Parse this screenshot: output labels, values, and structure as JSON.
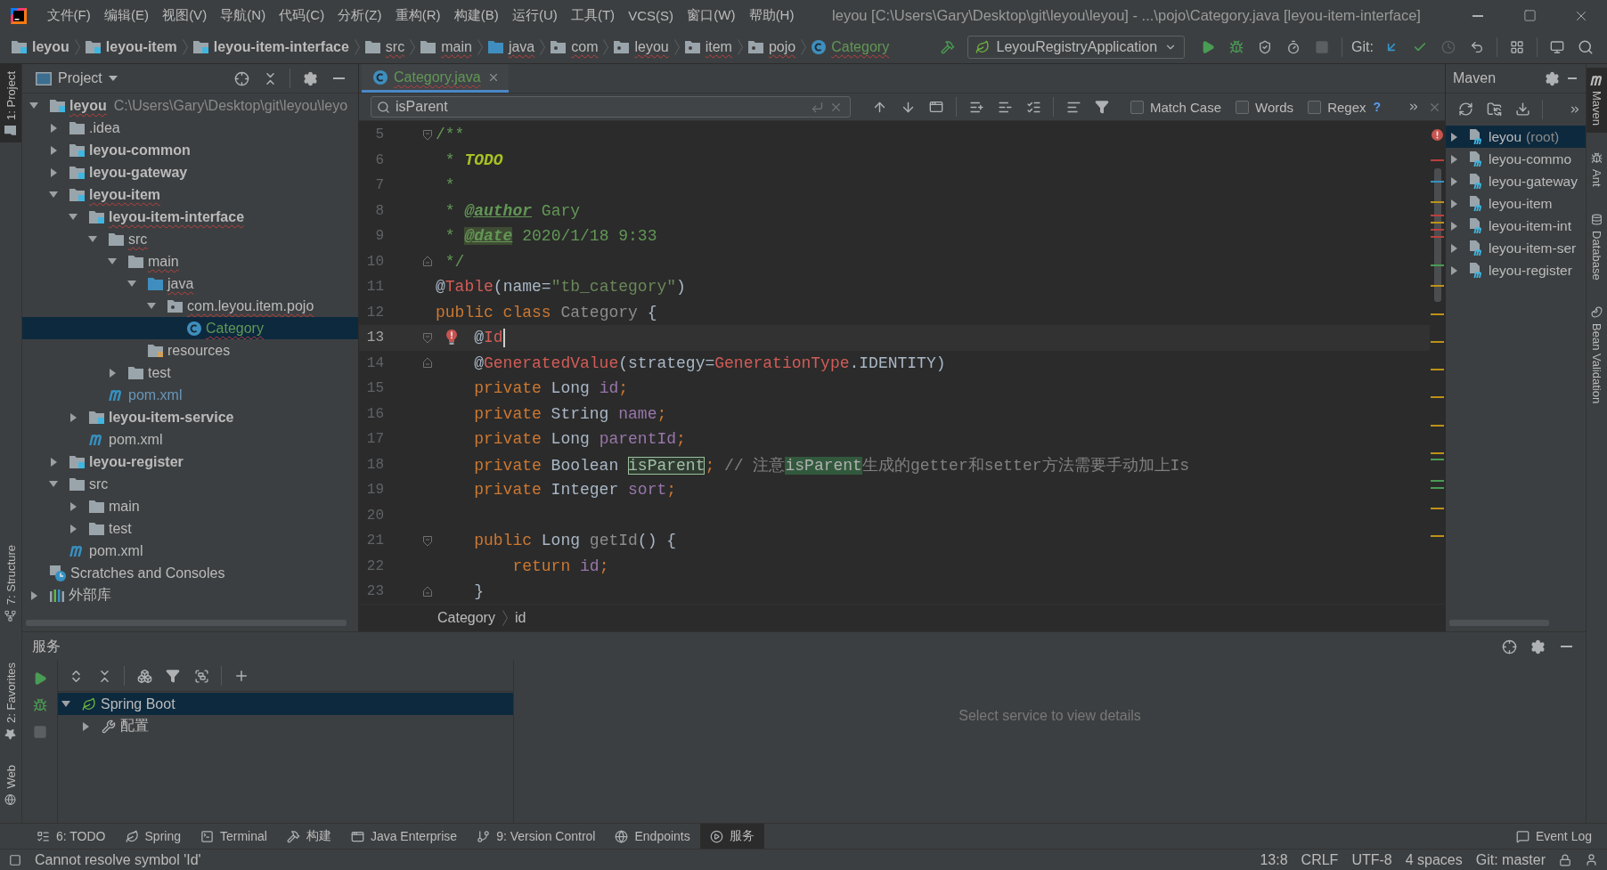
{
  "window": {
    "title": "leyou [C:\\Users\\Gary\\Desktop\\git\\leyou\\leyou] - ...\\pojo\\Category.java [leyou-item-interface]"
  },
  "menu": [
    "文件(F)",
    "编辑(E)",
    "视图(V)",
    "导航(N)",
    "代码(C)",
    "分析(Z)",
    "重构(R)",
    "构建(B)",
    "运行(U)",
    "工具(T)",
    "VCS(S)",
    "窗口(W)",
    "帮助(H)"
  ],
  "navbar": {
    "crumbs": [
      {
        "label": "leyou",
        "kind": "module",
        "errors": false,
        "added": false
      },
      {
        "label": "leyou-item",
        "kind": "module",
        "errors": false,
        "added": false
      },
      {
        "label": "leyou-item-interface",
        "kind": "module",
        "errors": false,
        "added": false
      },
      {
        "label": "src",
        "kind": "folder",
        "errors": true,
        "added": false
      },
      {
        "label": "main",
        "kind": "folder",
        "errors": true,
        "added": false
      },
      {
        "label": "java",
        "kind": "source",
        "errors": true,
        "added": false
      },
      {
        "label": "com",
        "kind": "package",
        "errors": true,
        "added": false
      },
      {
        "label": "leyou",
        "kind": "package",
        "errors": true,
        "added": false
      },
      {
        "label": "item",
        "kind": "package",
        "errors": true,
        "added": false
      },
      {
        "label": "pojo",
        "kind": "package",
        "errors": true,
        "added": false
      },
      {
        "label": "Category",
        "kind": "class",
        "errors": true,
        "added": true
      }
    ],
    "run_config": "LeyouRegistryApplication",
    "run_actions": [
      {
        "kind": "run",
        "disabled": false
      },
      {
        "kind": "debug",
        "disabled": false
      },
      {
        "kind": "coverage",
        "disabled": false
      },
      {
        "kind": "profile",
        "disabled": false
      },
      {
        "kind": "stop",
        "disabled": true
      }
    ],
    "git_label": "Git:",
    "git_actions": [
      {
        "kind": "update",
        "disabled": false
      },
      {
        "kind": "commit",
        "disabled": false
      },
      {
        "kind": "history",
        "disabled": true
      },
      {
        "kind": "rollback",
        "disabled": false
      }
    ]
  },
  "left_stripe": {
    "top": [
      {
        "label": "1: Project",
        "kind": "project",
        "selected": true
      },
      {
        "label": "7: Structure",
        "kind": "structure",
        "selected": false
      }
    ],
    "bottom": [
      {
        "label": "2: Favorites",
        "kind": "favorites",
        "selected": false
      },
      {
        "label": "Web",
        "kind": "web",
        "selected": false
      }
    ]
  },
  "project_panel": {
    "title": "Project",
    "tree": [
      {
        "label": "leyou",
        "kind": "module",
        "path": "C:\\Users\\Gary\\Desktop\\git\\leyou\\leyo",
        "expanded": true,
        "selected": false,
        "errors": true,
        "added": false,
        "modified": false,
        "children": [
          {
            "label": ".idea",
            "kind": "folder",
            "expanded": false,
            "selected": false,
            "errors": false,
            "added": false,
            "modified": false
          },
          {
            "label": "leyou-common",
            "kind": "module",
            "expanded": false,
            "selected": false,
            "errors": false,
            "added": false,
            "modified": false
          },
          {
            "label": "leyou-gateway",
            "kind": "module",
            "expanded": false,
            "selected": false,
            "errors": false,
            "added": false,
            "modified": false
          },
          {
            "label": "leyou-item",
            "kind": "module",
            "expanded": true,
            "selected": false,
            "errors": true,
            "added": false,
            "modified": false,
            "children": [
              {
                "label": "leyou-item-interface",
                "kind": "module",
                "expanded": true,
                "selected": false,
                "errors": true,
                "added": false,
                "modified": false,
                "children": [
                  {
                    "label": "src",
                    "kind": "folder",
                    "expanded": true,
                    "selected": false,
                    "errors": true,
                    "added": false,
                    "modified": false,
                    "children": [
                      {
                        "label": "main",
                        "kind": "folder",
                        "expanded": true,
                        "selected": false,
                        "errors": true,
                        "added": false,
                        "modified": false,
                        "children": [
                          {
                            "label": "java",
                            "kind": "source",
                            "expanded": true,
                            "selected": false,
                            "errors": true,
                            "added": false,
                            "modified": false,
                            "children": [
                              {
                                "label": "com.leyou.item.pojo",
                                "kind": "package",
                                "expanded": true,
                                "selected": false,
                                "errors": true,
                                "added": false,
                                "modified": false,
                                "children": [
                                  {
                                    "label": "Category",
                                    "kind": "class",
                                    "selected": true,
                                    "errors": true,
                                    "added": true,
                                    "modified": false
                                  }
                                ]
                              }
                            ]
                          },
                          {
                            "label": "resources",
                            "kind": "resources",
                            "selected": false,
                            "errors": false,
                            "added": false,
                            "modified": false
                          }
                        ]
                      },
                      {
                        "label": "test",
                        "kind": "folder",
                        "expanded": false,
                        "selected": false,
                        "errors": false,
                        "added": false,
                        "modified": false
                      }
                    ]
                  },
                  {
                    "label": "pom.xml",
                    "kind": "pom",
                    "selected": false,
                    "errors": false,
                    "added": false,
                    "modified": true
                  }
                ]
              },
              {
                "label": "leyou-item-service",
                "kind": "module",
                "expanded": false,
                "selected": false,
                "errors": false,
                "added": false,
                "modified": false
              },
              {
                "label": "pom.xml",
                "kind": "pom",
                "selected": false,
                "errors": false,
                "added": false,
                "modified": false
              }
            ]
          },
          {
            "label": "leyou-register",
            "kind": "module",
            "expanded": false,
            "selected": false,
            "errors": false,
            "added": false,
            "modified": false
          },
          {
            "label": "src",
            "kind": "folder",
            "expanded": true,
            "selected": false,
            "errors": false,
            "added": false,
            "modified": false,
            "children": [
              {
                "label": "main",
                "kind": "folder",
                "expanded": false,
                "selected": false,
                "errors": false,
                "added": false,
                "modified": false
              },
              {
                "label": "test",
                "kind": "folder",
                "expanded": false,
                "selected": false,
                "errors": false,
                "added": false,
                "modified": false
              }
            ]
          },
          {
            "label": "pom.xml",
            "kind": "pom",
            "selected": false,
            "errors": false,
            "added": false,
            "modified": false
          }
        ]
      },
      {
        "label": "Scratches and Consoles",
        "kind": "scratches",
        "selected": false,
        "errors": false,
        "added": false,
        "modified": false
      },
      {
        "label": "外部库",
        "kind": "library",
        "expanded": false,
        "selected": false,
        "errors": false,
        "added": false,
        "modified": false
      }
    ]
  },
  "editor": {
    "tabs": [
      {
        "label": "Category.java",
        "selected": true,
        "errors": true,
        "added": true
      }
    ],
    "find": {
      "value": "isParent",
      "options": [
        {
          "label": "Match Case",
          "checked": false
        },
        {
          "label": "Words",
          "checked": false
        },
        {
          "label": "Regex",
          "checked": false
        }
      ],
      "help": "?"
    },
    "lines": [
      {
        "number": "5",
        "fold": {
          "kind": "open"
        },
        "current": false,
        "caret": false,
        "bulb": false,
        "tokens": [
          {
            "kind": "doc",
            "text": "/**"
          }
        ]
      },
      {
        "number": "6",
        "current": false,
        "caret": false,
        "bulb": false,
        "tokens": [
          {
            "kind": "doc",
            "text": " * "
          },
          {
            "kind": "todo",
            "text": "TODO"
          }
        ]
      },
      {
        "number": "7",
        "current": false,
        "caret": false,
        "bulb": false,
        "tokens": [
          {
            "kind": "doc",
            "text": " *"
          }
        ]
      },
      {
        "number": "8",
        "current": false,
        "caret": false,
        "bulb": false,
        "tokens": [
          {
            "kind": "doc",
            "text": " * "
          },
          {
            "kind": "doc-tag",
            "text": "@author"
          },
          {
            "kind": "doc",
            "text": " Gary"
          }
        ]
      },
      {
        "number": "9",
        "current": false,
        "caret": false,
        "bulb": false,
        "tokens": [
          {
            "kind": "doc",
            "text": " * "
          },
          {
            "kind": "doc-tag-warn",
            "text": "@date"
          },
          {
            "kind": "doc",
            "text": " 2020/1/18 9:33"
          }
        ]
      },
      {
        "number": "10",
        "fold": {
          "kind": "close"
        },
        "current": false,
        "caret": false,
        "bulb": false,
        "tokens": [
          {
            "kind": "doc",
            "text": " */"
          }
        ]
      },
      {
        "number": "11",
        "current": false,
        "caret": false,
        "bulb": false,
        "tokens": [
          {
            "kind": "plain",
            "text": "@"
          },
          {
            "kind": "unresolved",
            "text": "Table"
          },
          {
            "kind": "plain",
            "text": "(name="
          },
          {
            "kind": "string",
            "text": "\"tb_category\""
          },
          {
            "kind": "plain",
            "text": ")"
          }
        ]
      },
      {
        "number": "12",
        "current": false,
        "caret": false,
        "bulb": false,
        "tokens": [
          {
            "kind": "keyword",
            "text": "public class "
          },
          {
            "kind": "unused",
            "text": "Category"
          },
          {
            "kind": "plain",
            "text": " {"
          }
        ]
      },
      {
        "number": "13",
        "fold": {
          "kind": "open"
        },
        "current": true,
        "caret": true,
        "bulb": true,
        "tokens": [
          {
            "kind": "plain",
            "text": "    @"
          },
          {
            "kind": "unresolved",
            "text": "Id"
          }
        ]
      },
      {
        "number": "14",
        "fold": {
          "kind": "close"
        },
        "current": false,
        "caret": false,
        "bulb": false,
        "tokens": [
          {
            "kind": "plain",
            "text": "    @"
          },
          {
            "kind": "unresolved",
            "text": "GeneratedValue"
          },
          {
            "kind": "plain",
            "text": "(strategy="
          },
          {
            "kind": "unresolved",
            "text": "GenerationType"
          },
          {
            "kind": "plain",
            "text": ".IDENTITY)"
          }
        ]
      },
      {
        "number": "15",
        "current": false,
        "caret": false,
        "bulb": false,
        "tokens": [
          {
            "kind": "keyword",
            "text": "    private "
          },
          {
            "kind": "plain",
            "text": "Long "
          },
          {
            "kind": "field",
            "text": "id"
          },
          {
            "kind": "keyword",
            "text": ";"
          }
        ]
      },
      {
        "number": "16",
        "current": false,
        "caret": false,
        "bulb": false,
        "tokens": [
          {
            "kind": "keyword",
            "text": "    private "
          },
          {
            "kind": "plain",
            "text": "String "
          },
          {
            "kind": "field",
            "text": "name"
          },
          {
            "kind": "keyword",
            "text": ";"
          }
        ]
      },
      {
        "number": "17",
        "current": false,
        "caret": false,
        "bulb": false,
        "tokens": [
          {
            "kind": "keyword",
            "text": "    private "
          },
          {
            "kind": "plain",
            "text": "Long "
          },
          {
            "kind": "field",
            "text": "parentId"
          },
          {
            "kind": "keyword",
            "text": ";"
          }
        ]
      },
      {
        "number": "18",
        "current": false,
        "caret": false,
        "bulb": false,
        "tokens": [
          {
            "kind": "keyword",
            "text": "    private "
          },
          {
            "kind": "plain",
            "text": "Boolean "
          },
          {
            "kind": "match-current",
            "text": "isParent"
          },
          {
            "kind": "keyword",
            "text": ";"
          },
          {
            "kind": "comment",
            "text": " // 注意"
          },
          {
            "kind": "match",
            "text": "isParent"
          },
          {
            "kind": "comment",
            "text": "生成的getter和setter方法需要手动加上Is"
          }
        ]
      },
      {
        "number": "19",
        "current": false,
        "caret": false,
        "bulb": false,
        "tokens": [
          {
            "kind": "keyword",
            "text": "    private "
          },
          {
            "kind": "plain",
            "text": "Integer "
          },
          {
            "kind": "field",
            "text": "sort"
          },
          {
            "kind": "keyword",
            "text": ";"
          }
        ]
      },
      {
        "number": "20",
        "current": false,
        "caret": false,
        "bulb": false
      },
      {
        "number": "21",
        "fold": {
          "kind": "open"
        },
        "current": false,
        "caret": false,
        "bulb": false,
        "tokens": [
          {
            "kind": "keyword",
            "text": "    public "
          },
          {
            "kind": "plain",
            "text": "Long "
          },
          {
            "kind": "unused",
            "text": "getId"
          },
          {
            "kind": "plain",
            "text": "() {"
          }
        ]
      },
      {
        "number": "22",
        "current": false,
        "caret": false,
        "bulb": false,
        "tokens": [
          {
            "kind": "keyword",
            "text": "        return "
          },
          {
            "kind": "field",
            "text": "id"
          },
          {
            "kind": "keyword",
            "text": ";"
          }
        ]
      },
      {
        "number": "23",
        "fold": {
          "kind": "close"
        },
        "current": false,
        "caret": false,
        "bulb": false,
        "tokens": [
          {
            "kind": "plain",
            "text": "    }"
          }
        ]
      }
    ],
    "breadcrumbs": [
      "Category",
      "id"
    ]
  },
  "maven": {
    "title": "Maven",
    "items": [
      {
        "label": "leyou",
        "suffix": "(root)",
        "expanded": false,
        "selected": true
      },
      {
        "label": "leyou-commo",
        "expanded": false,
        "selected": false
      },
      {
        "label": "leyou-gateway",
        "expanded": false,
        "selected": false
      },
      {
        "label": "leyou-item",
        "expanded": false,
        "selected": false
      },
      {
        "label": "leyou-item-int",
        "expanded": false,
        "selected": false
      },
      {
        "label": "leyou-item-ser",
        "expanded": false,
        "selected": false
      },
      {
        "label": "leyou-register",
        "expanded": false,
        "selected": false
      }
    ]
  },
  "right_stripe": [
    {
      "label": "Maven",
      "kind": "maven",
      "selected": true
    },
    {
      "label": "Ant",
      "kind": "ant",
      "selected": false
    },
    {
      "label": "Database",
      "kind": "database",
      "selected": false
    },
    {
      "label": "Bean Validation",
      "kind": "bean",
      "selected": false
    }
  ],
  "services": {
    "title": "服务",
    "actions": [
      {
        "kind": "run",
        "disabled": false
      },
      {
        "kind": "debug",
        "disabled": false
      },
      {
        "kind": "stop",
        "disabled": true
      }
    ],
    "tree": [
      {
        "label": "Spring Boot",
        "kind": "spring",
        "expanded": true,
        "selected": true,
        "children": [
          {
            "label": "配置",
            "kind": "config",
            "expanded": false,
            "selected": false
          }
        ]
      }
    ],
    "empty_text": "Select service to view details"
  },
  "tool_tabs": [
    {
      "label": "6: TODO",
      "kind": "todo",
      "selected": false
    },
    {
      "label": "Spring",
      "kind": "spring",
      "selected": false
    },
    {
      "label": "Terminal",
      "kind": "terminal",
      "selected": false
    },
    {
      "label": "构建",
      "kind": "build",
      "selected": false
    },
    {
      "label": "Java Enterprise",
      "kind": "javaee",
      "selected": false
    },
    {
      "label": "9: Version Control",
      "kind": "vcs",
      "selected": false
    },
    {
      "label": "Endpoints",
      "kind": "endpoints",
      "selected": false
    },
    {
      "label": "服务",
      "kind": "services",
      "selected": true
    }
  ],
  "event_log": "Event Log",
  "status_bar": {
    "message": "Cannot resolve symbol 'Id'",
    "items": [
      "13:8",
      "CRLF",
      "UTF-8",
      "4 spaces",
      "Git: master"
    ]
  }
}
